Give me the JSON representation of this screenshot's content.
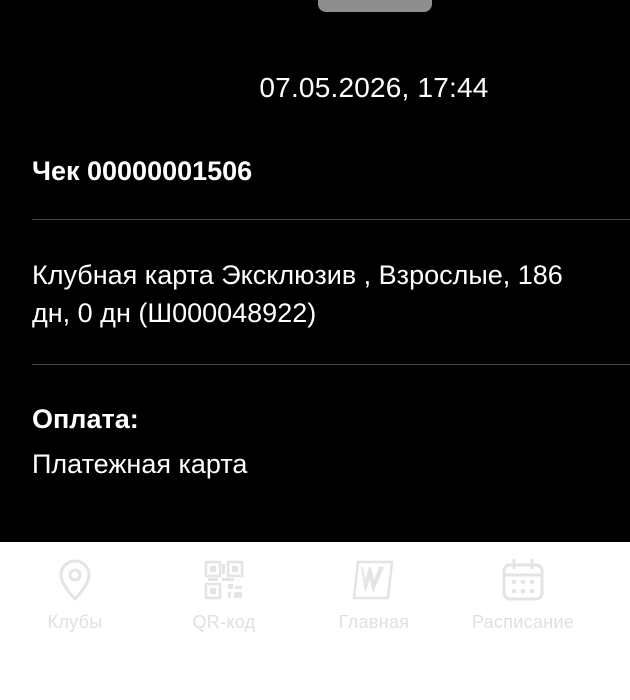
{
  "receipt": {
    "datetime": "07.05.2026, 17:44",
    "title": "Чек 00000001506",
    "item": "Клубная карта Эксклюзив , Взрослые, 186 дн, 0 дн (Ш000048922)",
    "payment_label": "Оплата:",
    "payment_method": "Платежная карта"
  },
  "tabbar": {
    "items": [
      {
        "label": "Клубы",
        "icon": "location-pin-icon"
      },
      {
        "label": "QR-код",
        "icon": "qr-code-icon"
      },
      {
        "label": "Главная",
        "icon": "w-logo-icon"
      },
      {
        "label": "Расписание",
        "icon": "calendar-icon"
      }
    ]
  },
  "colors": {
    "background": "#000000",
    "text": "#ffffff",
    "tabbar_bg": "#ffffff",
    "tab_inactive": "#e4e4e4"
  }
}
